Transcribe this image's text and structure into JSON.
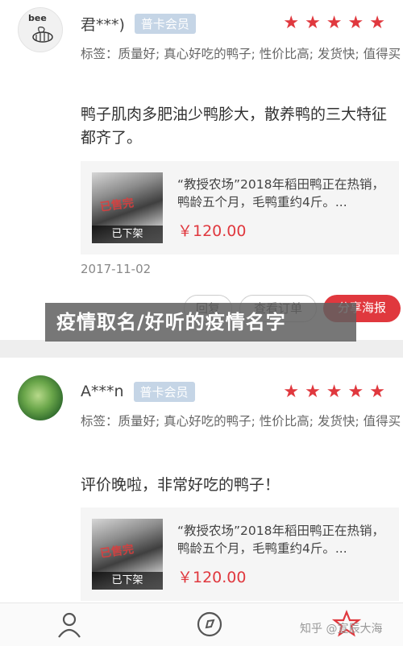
{
  "reviews": [
    {
      "avatar_text": "bee",
      "username": "君***)",
      "badge": "普卡会员",
      "rating_stars": 5,
      "tags": "标签：质量好; 真心好吃的鸭子; 性价比高; 发货快; 值得买",
      "comment": "鸭子肌肉多肥油少鸭胗大，散养鸭的三大特征都齐了。",
      "product": {
        "title": "“教授农场”2018年稻田鸭正在热销，鸭龄五个月，毛鸭重约4斤。...",
        "price": "￥120.00",
        "image_overlay": "已下架",
        "image_stamp": "已售完"
      },
      "date": "2017-11-02",
      "actions": {
        "reply": "回复",
        "view_order": "查看订单",
        "share": "分享海报"
      }
    },
    {
      "username": "A***n",
      "badge": "普卡会员",
      "rating_stars": 5,
      "tags": "标签：质量好; 真心好吃的鸭子; 性价比高; 发货快; 值得买",
      "comment": "评价晚啦，非常好吃的鸭子！",
      "product": {
        "title": "“教授农场”2018年稻田鸭正在热销，鸭龄五个月，毛鸭重约4斤。...",
        "price": "￥120.00",
        "image_overlay": "已下架",
        "image_stamp": "已售完"
      }
    }
  ],
  "overlay_title": "疫情取名/好听的疫情名字",
  "watermark": "知乎 @宣辰大海",
  "colors": {
    "accent_red": "#e0383e",
    "badge_blue": "#c5d5e6",
    "card_bg": "#f5f5f5"
  },
  "nav_icons": [
    "user-icon",
    "compass-icon",
    "star-icon"
  ]
}
